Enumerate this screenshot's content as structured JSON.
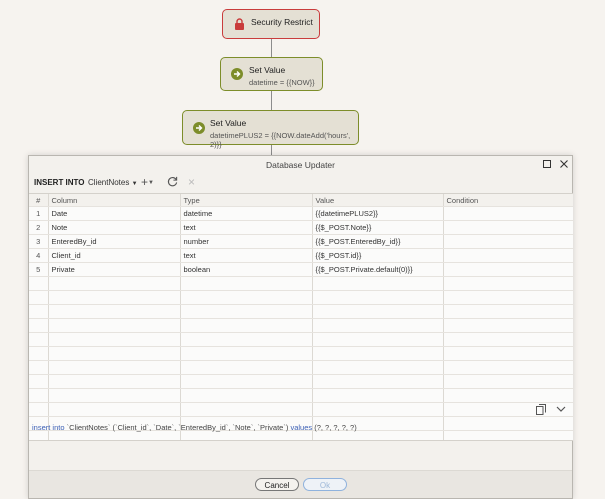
{
  "flow": {
    "security": {
      "title": "Security Restrict",
      "icon": "lock-icon",
      "color": "#c93c3c"
    },
    "set_value_1": {
      "title": "Set Value",
      "detail": "datetime = {{NOW}}",
      "icon": "arrow-right-circle-icon"
    },
    "set_value_2": {
      "title": "Set Value",
      "detail": "datetimePLUS2 = {{NOW.dateAdd('hours', 2)}}",
      "icon": "arrow-right-circle-icon"
    }
  },
  "dialog": {
    "title": "Database Updater",
    "maximize_icon": "maximize-icon",
    "close_icon": "close-icon",
    "toolbar": {
      "mode": "INSERT INTO",
      "table": "ClientNotes",
      "add_icon": "plus-icon",
      "refresh_icon": "refresh-icon",
      "remove_icon": "x-icon"
    },
    "columns": [
      "#",
      "Column",
      "Type",
      "Value",
      "Condition"
    ],
    "rows": [
      {
        "num": "1",
        "column": "Date",
        "type": "datetime",
        "value": "{{datetimePLUS2}}",
        "condition": ""
      },
      {
        "num": "2",
        "column": "Note",
        "type": "text",
        "value": "{{$_POST.Note}}",
        "condition": ""
      },
      {
        "num": "3",
        "column": "EnteredBy_id",
        "type": "number",
        "value": "{{$_POST.EnteredBy_id}}",
        "condition": ""
      },
      {
        "num": "4",
        "column": "Client_id",
        "type": "text",
        "value": "{{$_POST.id}}",
        "condition": ""
      },
      {
        "num": "5",
        "column": "Private",
        "type": "boolean",
        "value": "{{$_POST.Private.default(0)}}",
        "condition": ""
      }
    ],
    "sql": {
      "kw_insert": "insert into",
      "body": " `ClientNotes` (`Client_id`, `Date`, `EnteredBy_id`, `Note`, `Private`) ",
      "kw_values": "values",
      "params": " (?, ?, ?, ?, ?)"
    },
    "buttons": {
      "cancel": "Cancel",
      "ok": "Ok"
    },
    "colors": {
      "accent_green": "#7d8d2a",
      "sql_keyword": "#3b5fb5",
      "ok_border": "#8fb2dd"
    }
  }
}
